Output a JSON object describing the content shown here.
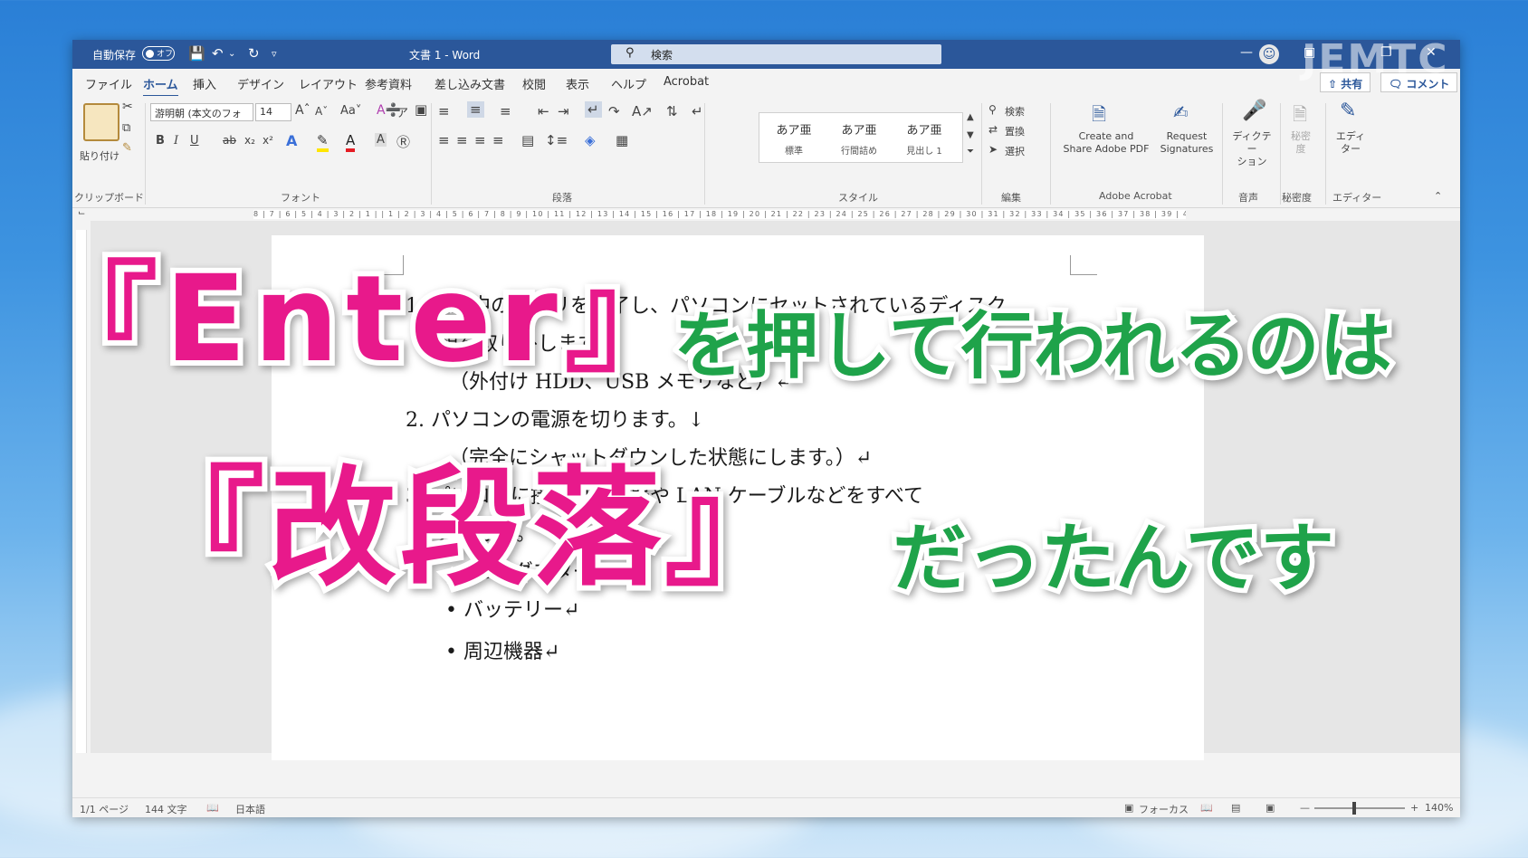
{
  "titlebar": {
    "autosave_label": "自動保存",
    "autosave_state": "オフ",
    "document_title": "文書 1  -  Word",
    "search_placeholder": "検索"
  },
  "menu": {
    "tabs": [
      "ファイル",
      "ホーム",
      "挿入",
      "デザイン",
      "レイアウト",
      "参考資料",
      "差し込み文書",
      "校閲",
      "表示",
      "ヘルプ",
      "Acrobat"
    ],
    "share_label": "共有",
    "comment_label": "コメント"
  },
  "ribbon": {
    "paste_label": "貼り付け",
    "font_name": "游明朝 (本文のフォ",
    "font_size": "14",
    "styles": [
      {
        "preview": "あア亜",
        "name": "標準"
      },
      {
        "preview": "あア亜",
        "name": "行間詰め"
      },
      {
        "preview": "あア亜",
        "name": "見出し 1"
      }
    ],
    "edit_items": [
      "検索",
      "置換",
      "選択"
    ],
    "acrobat_create": "Create and\nShare Adobe PDF",
    "acrobat_request": "Request\nSignatures",
    "dictate_label": "ディクテー\nション",
    "sensitivity_label": "秘密\n度",
    "editor_label": "エディ\nター",
    "group_labels": {
      "clipboard": "クリップボード",
      "font": "フォント",
      "paragraph": "段落",
      "styles": "スタイル",
      "editing": "編集",
      "acrobat": "Adobe Acrobat",
      "voice": "音声",
      "sensitivity": "秘密度",
      "editor": "エディター"
    }
  },
  "ruler": {
    "horizontal": "8 | 7 | 6 | 5 | 4 | 3 | 2 | 1 |   | 1 | 2 | 3 | 4 | 5 | 6 | 7 | 8 | 9 | 10 | 11 | 12 | 13 | 14 | 15 | 16 | 17 | 18 | 19 | 20 | 21 | 22 | 23 | 24 | 25 | 26 | 27 | 28 | 29 | 30 | 31 | 32 | 33 | 34 | 35 | 36 | 37 | 38 | 39 | 40 | 41 | 42 | 43 | 44 | 45 | 46 | 47 | 48 |"
  },
  "document": {
    "lines": [
      "1.  起動中のアプリを終了し、パソコンにセットされているディスク",
      "類を取り外します。",
      "（外付け HDD、USB メモリなど）↵",
      "2.  パソコンの電源を切ります。↓",
      "（完全にシャットダウンした状態にします。）↵",
      "3.  パソコンに接続周辺機器や LAN ケーブルなどをすべて",
      "外します。",
      "•   ACアダプター",
      "•   バッテリー↵",
      "•   周辺機器↵"
    ]
  },
  "statusbar": {
    "page": "1/1 ページ",
    "word_count": "144 文字",
    "language": "日本語",
    "focus": "フォーカス",
    "zoom": "140%"
  },
  "watermark": "JEMTC",
  "overlay": {
    "line1_pink": "『Enter』",
    "line1_green": "を押して行われるのは",
    "line2_pink": "『改段落』",
    "line2_green": "だったんです"
  }
}
